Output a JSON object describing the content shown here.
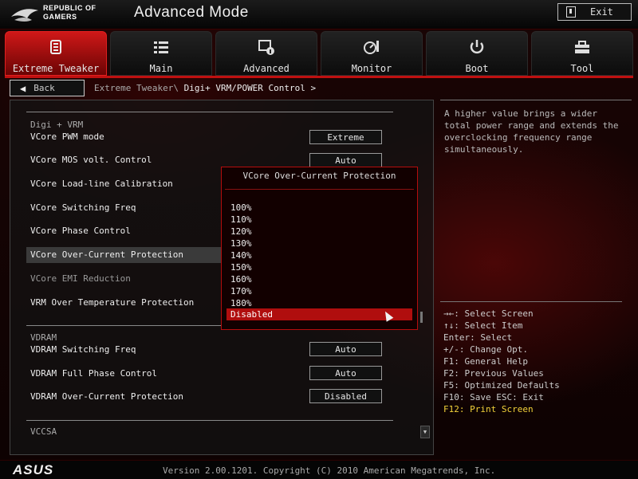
{
  "header": {
    "brand_line1": "REPUBLIC OF",
    "brand_line2": "GAMERS",
    "title": "Advanced Mode",
    "exit_label": "Exit"
  },
  "tabs": [
    {
      "label": "Extreme Tweaker",
      "icon": "extreme-tweaker-icon",
      "active": true
    },
    {
      "label": "Main",
      "icon": "list-icon"
    },
    {
      "label": "Advanced",
      "icon": "advanced-icon"
    },
    {
      "label": "Monitor",
      "icon": "monitor-gauge-icon"
    },
    {
      "label": "Boot",
      "icon": "power-icon"
    },
    {
      "label": "Tool",
      "icon": "toolbox-icon"
    }
  ],
  "nav": {
    "back_label": "Back",
    "breadcrumb_parent": "Extreme Tweaker\\",
    "breadcrumb_current": "Digi+ VRM/POWER Control >"
  },
  "settings": {
    "section_digi": "Digi + VRM",
    "vcore_pwm_label": "VCore PWM mode",
    "vcore_pwm_value": "Extreme",
    "vcore_mos_label": "VCore MOS volt. Control",
    "vcore_mos_value": "Auto",
    "vcore_llc_label": "VCore Load-line Calibration",
    "vcore_switch_label": "VCore Switching Freq",
    "vcore_phase_label": "VCore Phase Control",
    "vcore_ocp_label": "VCore Over-Current Protection",
    "vcore_emi_label": "VCore EMI Reduction",
    "vrm_temp_label": "VRM Over Temperature Protection",
    "section_vdram": "VDRAM",
    "vdram_switch_label": "VDRAM Switching Freq",
    "vdram_switch_value": "Auto",
    "vdram_phase_label": "VDRAM Full Phase Control",
    "vdram_phase_value": "Auto",
    "vdram_ocp_label": "VDRAM Over-Current Protection",
    "vdram_ocp_value": "Disabled",
    "section_vccsa": "VCCSA"
  },
  "popup": {
    "title": "VCore Over-Current Protection",
    "options": [
      "100%",
      "110%",
      "120%",
      "130%",
      "140%",
      "150%",
      "160%",
      "170%",
      "180%",
      "Disabled"
    ],
    "selected": "Disabled"
  },
  "help": {
    "description": "A higher value brings a wider total power range and extends the overclocking frequency range simultaneously.",
    "keys": [
      "→←: Select Screen",
      "↑↓: Select Item",
      "Enter: Select",
      "+/-: Change Opt.",
      "F1: General Help",
      "F2: Previous Values",
      "F5: Optimized Defaults",
      "F10: Save  ESC: Exit",
      "F12: Print Screen"
    ]
  },
  "footer": {
    "brand": "ASUS",
    "version": "Version 2.00.1201. Copyright (C) 2010 American Megatrends, Inc."
  }
}
